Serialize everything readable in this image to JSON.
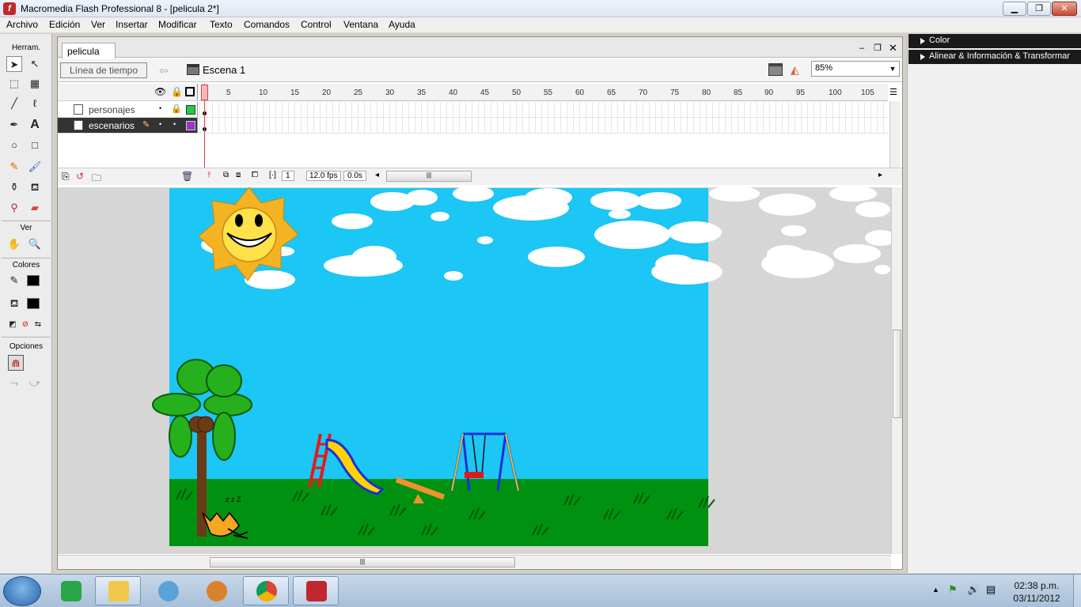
{
  "window": {
    "title": "Macromedia Flash Professional 8 - [pelicula 2*]"
  },
  "menu": [
    "Archivo",
    "Edición",
    "Ver",
    "Insertar",
    "Modificar",
    "Texto",
    "Comandos",
    "Control",
    "Ventana",
    "Ayuda"
  ],
  "tools": {
    "header": "Herram.",
    "view_header": "Ver",
    "colors_header": "Colores",
    "options_header": "Opciones"
  },
  "document": {
    "tab": "pelicula 2*",
    "timeline_button": "Línea de tiempo",
    "scene": "Escena 1",
    "zoom": "85%"
  },
  "timeline": {
    "ticks": [
      "5",
      "10",
      "15",
      "20",
      "25",
      "30",
      "35",
      "40",
      "45",
      "50",
      "55",
      "60",
      "65",
      "70",
      "75",
      "80",
      "85",
      "90",
      "95",
      "100",
      "105"
    ],
    "layers": [
      {
        "name": "personajes",
        "color": "#22cc44"
      },
      {
        "name": "escenarios",
        "color": "#9933cc"
      }
    ],
    "current_frame": "1",
    "fps": "12.0 fps",
    "elapsed": "0.0s"
  },
  "panels": [
    "Color",
    "Alinear & Información & Transformar"
  ],
  "taskbar": {
    "time": "02:38 p.m.",
    "date": "03/11/2012"
  },
  "colors": {
    "sky": "#1cc6f5",
    "grass": "#009110",
    "stage_bg": "#d6d6d6"
  }
}
